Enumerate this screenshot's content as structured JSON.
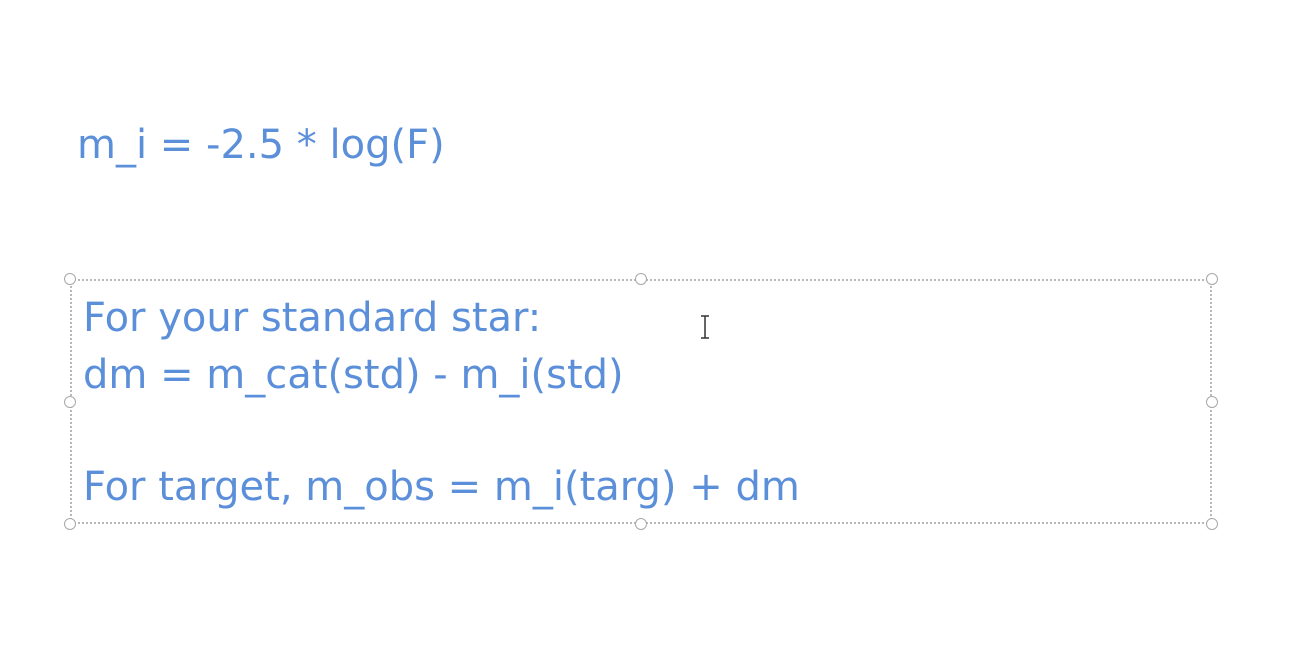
{
  "slide": {
    "formula": "m_i = -2.5 * log(F)",
    "textbox": {
      "line1": "For your standard star:",
      "line2": "dm = m_cat(std) - m_i(std)",
      "line3": "For target, m_obs = m_i(targ) + dm"
    }
  },
  "colors": {
    "text": "#5b8fd9",
    "selection_border": "#b8b8b8",
    "background": "#ffffff"
  },
  "icons": {
    "cursor": "text-cursor-icon"
  }
}
